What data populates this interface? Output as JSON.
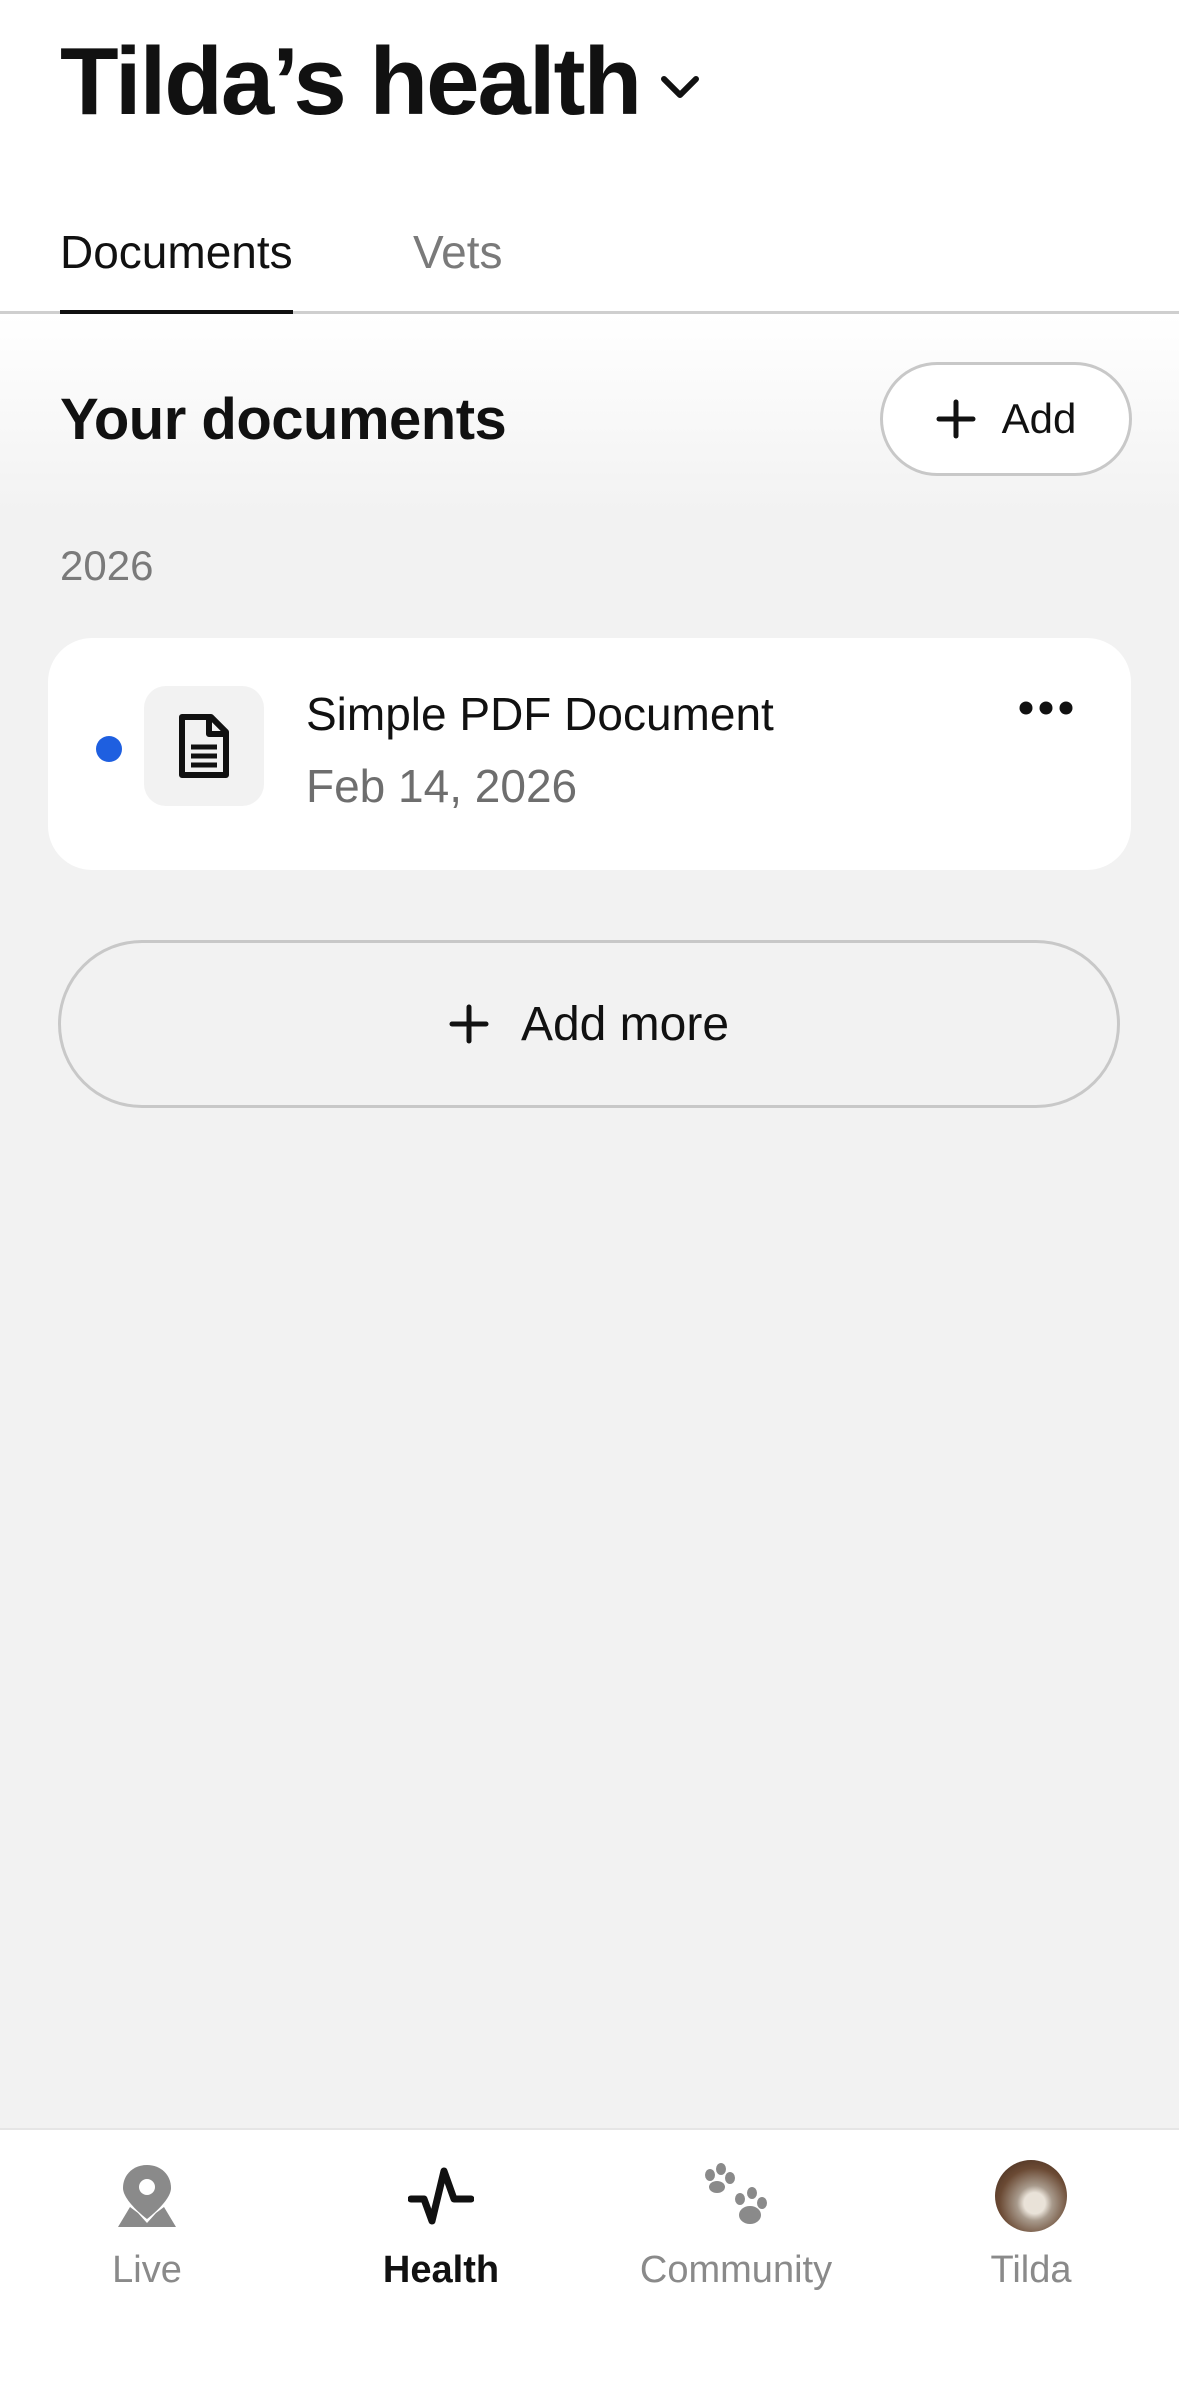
{
  "header": {
    "title": "Tilda’s health"
  },
  "tabs": [
    {
      "label": "Documents",
      "active": true
    },
    {
      "label": "Vets",
      "active": false
    }
  ],
  "documents_section": {
    "title": "Your documents",
    "add_label": "Add",
    "groups": [
      {
        "year": "2026",
        "items": [
          {
            "name": "Simple PDF Document",
            "date": "Feb 14, 2026",
            "unread": true,
            "icon": "document-icon"
          }
        ]
      }
    ],
    "add_more_label": "Add more"
  },
  "bottom_nav": [
    {
      "label": "Live",
      "icon": "location-pin-icon",
      "active": false
    },
    {
      "label": "Health",
      "icon": "pulse-icon",
      "active": true
    },
    {
      "label": "Community",
      "icon": "paw-icon",
      "active": false
    },
    {
      "label": "Tilda",
      "icon": "pet-avatar",
      "active": false
    }
  ],
  "colors": {
    "accent_dot": "#1e5fe0",
    "background": "#f2f2f2",
    "text_primary": "#111111",
    "text_secondary": "#7a7a7a"
  }
}
